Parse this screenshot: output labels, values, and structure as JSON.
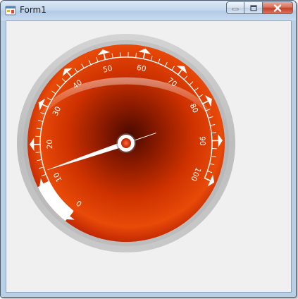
{
  "window": {
    "title": "Form1",
    "buttons": {
      "minimize_icon": "minimize-icon",
      "maximize_icon": "maximize-icon",
      "close_icon": "close-icon"
    }
  },
  "gauge": {
    "min": 0,
    "max": 100,
    "value": 13,
    "major_step": 10,
    "minor_per_major": 5,
    "labels": [
      "0",
      "10",
      "20",
      "30",
      "40",
      "50",
      "60",
      "70",
      "80",
      "90",
      "100"
    ],
    "range_band": {
      "from": 0,
      "to": 10,
      "color": "#ffffff"
    },
    "colors": {
      "face_outer": "#a11200",
      "face_mid": "#e64a08",
      "face_hot": "#ff7a1a",
      "bezel": "#c4c4c4",
      "cap": "#ffffff",
      "cap_center": "#e03a10"
    }
  }
}
